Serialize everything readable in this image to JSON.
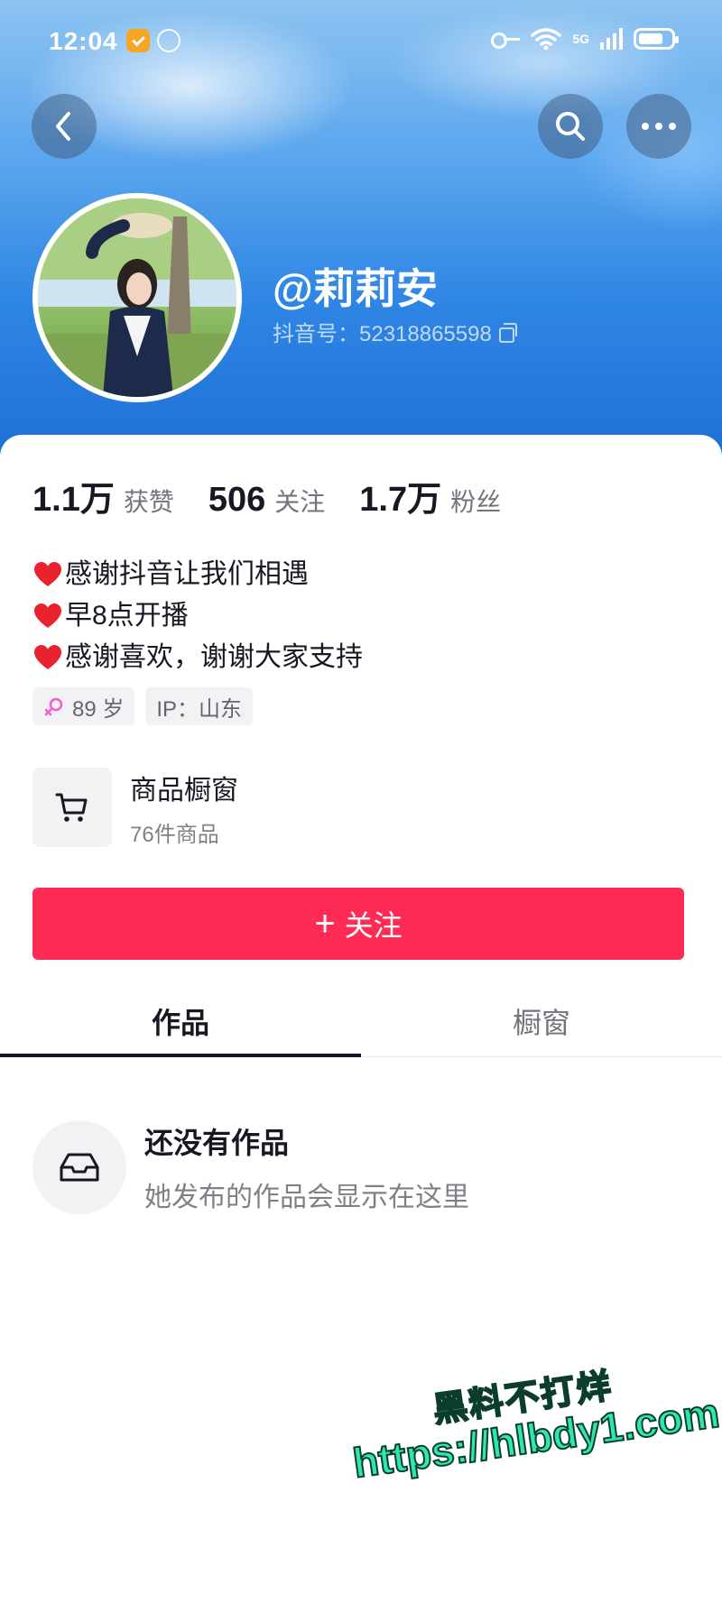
{
  "status_bar": {
    "time": "12:04",
    "network": "5G",
    "icons": [
      "shield-badge-icon",
      "hand-icon",
      "key-icon",
      "wifi-icon",
      "signal-icon",
      "battery-icon"
    ]
  },
  "top_bar": {
    "back_icon": "chevron-left-icon",
    "search_icon": "search-icon",
    "more_icon": "more-dots-icon"
  },
  "profile": {
    "username": "@莉莉安",
    "douyin_id": "抖音号：52318865598"
  },
  "stats": [
    {
      "value": "1.1万",
      "label": "获赞"
    },
    {
      "value": "506",
      "label": "关注"
    },
    {
      "value": "1.7万",
      "label": "粉丝"
    }
  ],
  "bio": [
    "感谢抖音让我们相遇",
    "早8点开播",
    "感谢喜欢，谢谢大家支持"
  ],
  "tags": {
    "age": "89 岁",
    "ip": "IP：山东"
  },
  "shop": {
    "title": "商品橱窗",
    "subtitle": "76件商品"
  },
  "follow_button": {
    "plus": "+",
    "label": "关注"
  },
  "tabs": [
    {
      "label": "作品",
      "active": true
    },
    {
      "label": "橱窗",
      "active": false
    }
  ],
  "empty_state": {
    "title": "还没有作品",
    "subtitle": "她发布的作品会显示在这里"
  },
  "watermark": {
    "line1": "黑料不打烊",
    "line2": "https://hlbdy1.com"
  },
  "colors": {
    "accent": "#fe2c55",
    "header_blue": "#2f86e4",
    "watermark_green": "#2ee6b0"
  }
}
